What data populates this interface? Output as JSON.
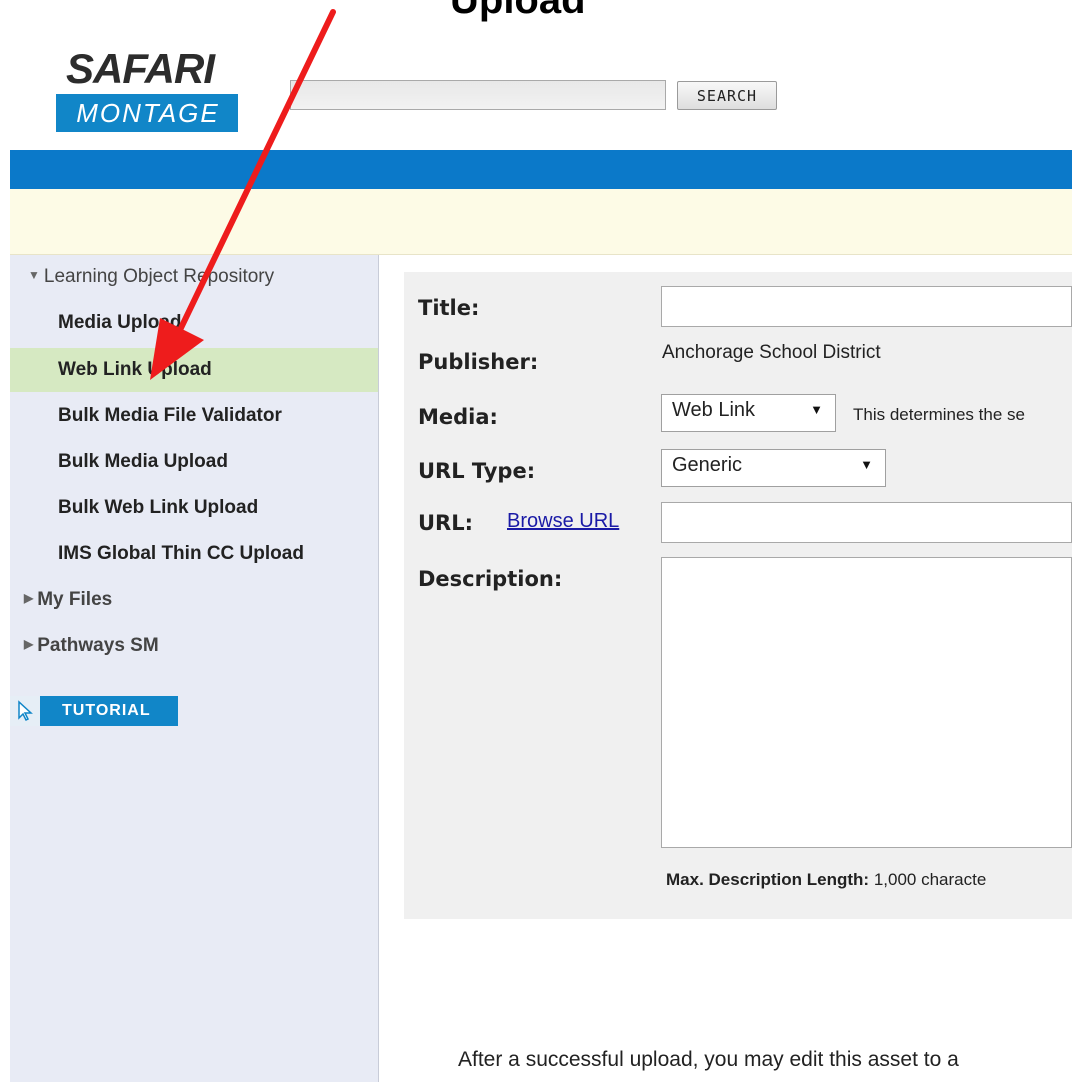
{
  "heading_fragment": "Upload",
  "logo": {
    "top": "SAFARI",
    "bottom": "MONTAGE"
  },
  "search": {
    "placeholder": "",
    "button_label": "SEARCH"
  },
  "sidebar": {
    "section_open": "Learning Object Repository",
    "items": [
      {
        "label": "Media Upload"
      },
      {
        "label": "Web Link Upload"
      },
      {
        "label": "Bulk Media File Validator"
      },
      {
        "label": "Bulk Media Upload"
      },
      {
        "label": "Bulk Web Link Upload"
      },
      {
        "label": "IMS Global Thin CC Upload"
      }
    ],
    "section_my_files": "My Files",
    "section_pathways": "Pathways SM",
    "tutorial_label": "TUTORIAL"
  },
  "form": {
    "title_label": "Title:",
    "title_value": "",
    "publisher_label": "Publisher:",
    "publisher_value": "Anchorage School District",
    "media_label": "Media:",
    "media_value": "Web Link",
    "media_hint": "This determines the se",
    "url_type_label": "URL Type:",
    "url_type_value": "Generic",
    "url_label": "URL:",
    "browse_url": "Browse URL",
    "url_value": "",
    "description_label": "Description:",
    "description_value": "",
    "max_length_label": "Max. Description Length:",
    "max_length_value": "1,000 characte"
  },
  "footer_note": "After a successful upload, you may edit this asset to a",
  "colors": {
    "brand_blue": "#0b79c9",
    "active_row": "#d6e9c2",
    "arrow": "#ee1c1c"
  }
}
